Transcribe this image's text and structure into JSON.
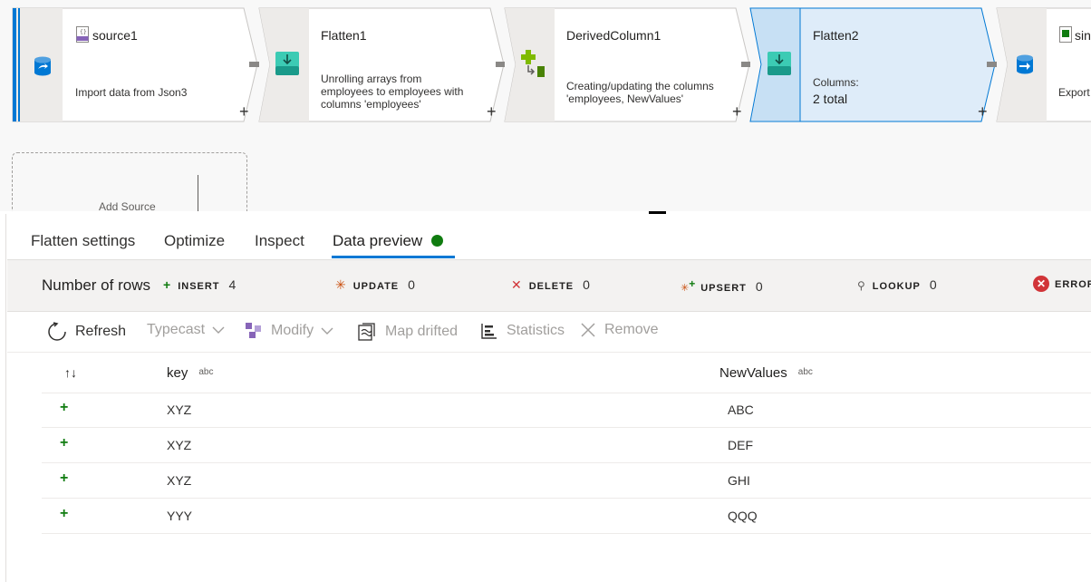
{
  "pipeline": {
    "nodes": [
      {
        "title": "source1",
        "description": [
          "Import data from Json3"
        ]
      },
      {
        "title": "Flatten1",
        "description": [
          "Unrolling arrays from",
          "employees to employees with",
          "columns 'employees'"
        ]
      },
      {
        "title": "DerivedColumn1",
        "description": [
          "Creating/updating the columns",
          "'employees, NewValues'"
        ]
      },
      {
        "title": "Flatten2",
        "sub_label": "Columns:",
        "sub_value": "2 total"
      },
      {
        "title": "sin",
        "description": [
          "Export"
        ]
      }
    ],
    "add_symbol": "+",
    "add_source_label": "Add Source"
  },
  "tabs": [
    {
      "label": "Flatten settings"
    },
    {
      "label": "Optimize"
    },
    {
      "label": "Inspect"
    },
    {
      "label": "Data preview"
    }
  ],
  "stats": {
    "title": "Number of rows",
    "insert": {
      "label": "INSERT",
      "count": "4"
    },
    "update": {
      "label": "UPDATE",
      "count": "0"
    },
    "delete": {
      "label": "DELETE",
      "count": "0"
    },
    "upsert": {
      "label": "UPSERT",
      "count": "0"
    },
    "lookup": {
      "label": "LOOKUP",
      "count": "0"
    },
    "error": {
      "label": "ERROR"
    }
  },
  "toolbar": {
    "refresh": "Refresh",
    "typecast": "Typecast",
    "modify": "Modify",
    "map_drifted": "Map drifted",
    "statistics": "Statistics",
    "remove": "Remove"
  },
  "grid": {
    "sort_symbol": "↑↓",
    "columns": [
      {
        "name": "key",
        "type": "abc"
      },
      {
        "name": "NewValues",
        "type": "abc"
      }
    ],
    "row_marker": "+",
    "rows": [
      [
        "XYZ",
        "ABC"
      ],
      [
        "XYZ",
        "DEF"
      ],
      [
        "XYZ",
        "GHI"
      ],
      [
        "YYY",
        "QQQ"
      ]
    ]
  },
  "colors": {
    "accent": "#0078d4",
    "success": "#107c10",
    "error": "#d13438",
    "selected_node": "#deecf9",
    "selected_border": "#0078d4"
  }
}
